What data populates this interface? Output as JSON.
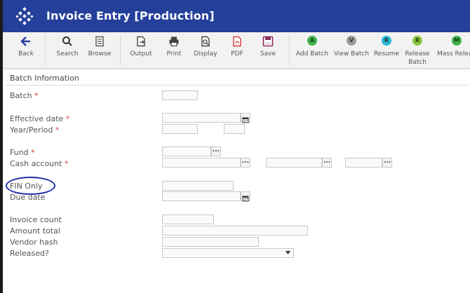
{
  "app": {
    "title": "Invoice Entry [Production]"
  },
  "toolbar": {
    "back": "Back",
    "search": "Search",
    "browse": "Browse",
    "output": "Output",
    "print": "Print",
    "display": "Display",
    "pdf": "PDF",
    "save": "Save",
    "add_batch": "Add Batch",
    "view_batch": "View Batch",
    "resume": "Resume",
    "release_batch": "Release Batch",
    "mass_release": "Mass Release",
    "add_batch_glyph": "A",
    "view_batch_glyph": "V",
    "resume_glyph": "R",
    "release_batch_glyph": "R",
    "mass_release_glyph": "M"
  },
  "form": {
    "section_title": "Batch Information",
    "batch_label": "Batch",
    "effective_date_label": "Effective date",
    "year_period_label": "Year/Period",
    "fund_label": "Fund",
    "cash_account_label": "Cash account",
    "fin_only_label": "FIN Only",
    "due_date_label": "Due date",
    "invoice_count_label": "Invoice count",
    "amount_total_label": "Amount total",
    "vendor_hash_label": "Vendor hash",
    "released_label": "Released?",
    "required_mark": "*",
    "lookup_glyph": "..."
  },
  "colors": {
    "header_bg": "#24409a",
    "required": "#d43c3c",
    "annotation_ring": "#1c2fa6",
    "add_batch": "#3db34a",
    "view_batch": "#9a9a9a",
    "resume": "#29b5d9",
    "release_batch": "#8cc63f",
    "mass_release": "#3db34a"
  },
  "icons": [
    "back-arrow-icon",
    "search-icon",
    "browse-icon",
    "output-icon",
    "print-icon",
    "display-icon",
    "pdf-icon",
    "save-icon",
    "calendar-icon"
  ]
}
